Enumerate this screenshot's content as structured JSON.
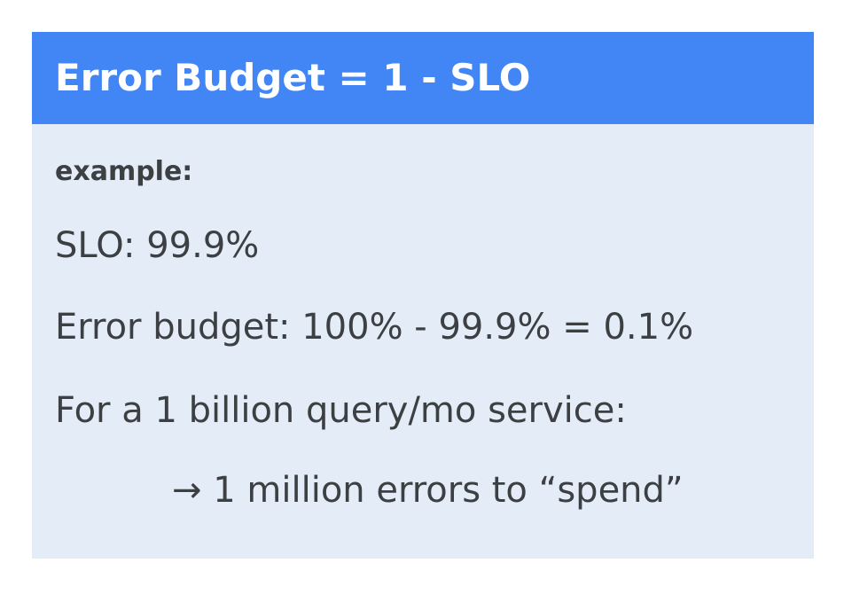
{
  "header": {
    "title": "Error Budget = 1 - SLO"
  },
  "body": {
    "example_label": "example:",
    "slo": "SLO: 99.9%",
    "error_budget": "Error budget: 100% - 99.9% = 0.1%",
    "service": "For a 1 billion query/mo service:",
    "result": "→ 1 million errors to “spend”"
  },
  "colors": {
    "header_bg": "#4285f4",
    "card_bg": "#e4ecf8",
    "text": "#3c4043"
  }
}
